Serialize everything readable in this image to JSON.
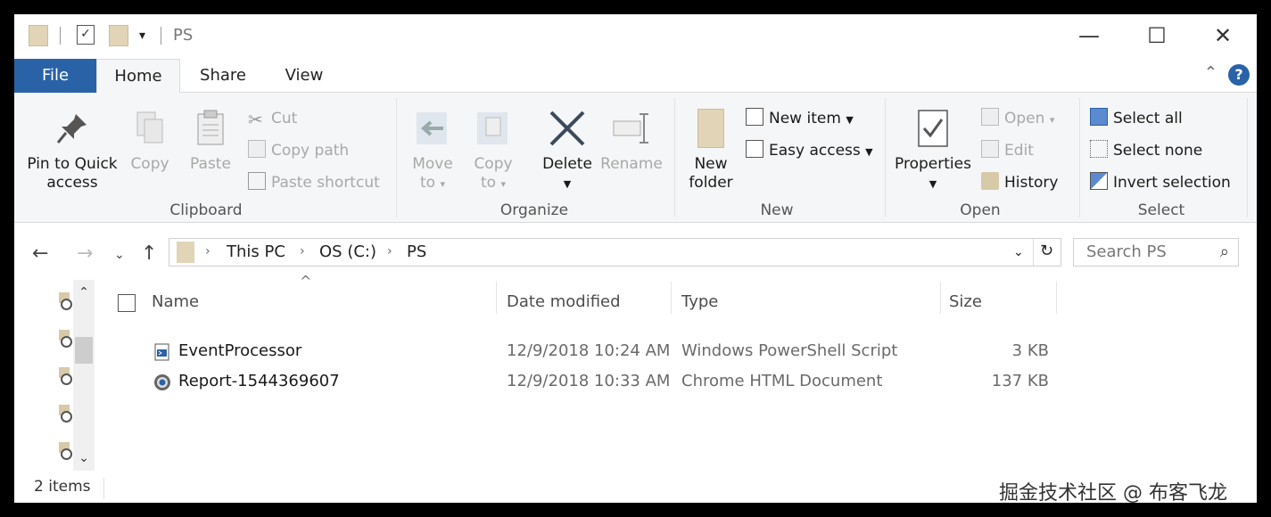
{
  "window": {
    "title": "PS",
    "controls": {
      "minimize": "—",
      "maximize": "☐",
      "close": "✕"
    }
  },
  "ribbon_tabs": [
    {
      "label": "File"
    },
    {
      "label": "Home"
    },
    {
      "label": "Share"
    },
    {
      "label": "View"
    }
  ],
  "ribbon": {
    "clipboard": {
      "label": "Clipboard",
      "pin_line1": "Pin to Quick",
      "pin_line2": "access",
      "copy": "Copy",
      "paste": "Paste",
      "cut": "Cut",
      "copy_path": "Copy path",
      "paste_shortcut": "Paste shortcut"
    },
    "organize": {
      "label": "Organize",
      "move_line1": "Move",
      "move_line2": "to",
      "copy_line1": "Copy",
      "copy_line2": "to",
      "delete": "Delete",
      "rename": "Rename"
    },
    "new": {
      "label": "New",
      "folder_line1": "New",
      "folder_line2": "folder",
      "new_item": "New item",
      "easy_access": "Easy access"
    },
    "open": {
      "label": "Open",
      "properties": "Properties",
      "open": "Open",
      "edit": "Edit",
      "history": "History"
    },
    "select": {
      "label": "Select",
      "select_all": "Select all",
      "select_none": "Select none",
      "invert_selection": "Invert selection"
    }
  },
  "address": {
    "crumbs": [
      "This PC",
      "OS (C:)",
      "PS"
    ],
    "search_placeholder": "Search PS"
  },
  "columns": {
    "name": "Name",
    "date_modified": "Date modified",
    "type": "Type",
    "size": "Size"
  },
  "files": [
    {
      "name": "EventProcessor",
      "date": "12/9/2018 10:24 AM",
      "type": "Windows PowerShell Script",
      "size": "3 KB",
      "icon": "powershell-script-icon"
    },
    {
      "name": "Report-1544369607",
      "date": "12/9/2018 10:33 AM",
      "type": "Chrome HTML Document",
      "size": "137 KB",
      "icon": "chrome-html-icon"
    }
  ],
  "status": {
    "items_count": "2 items",
    "watermark": "掘金技术社区 @ 布客飞龙"
  },
  "colors": {
    "file_tab": "#2a62a8",
    "ribbon_bg": "#f5f6f7",
    "folder": "#e2d4b7"
  }
}
